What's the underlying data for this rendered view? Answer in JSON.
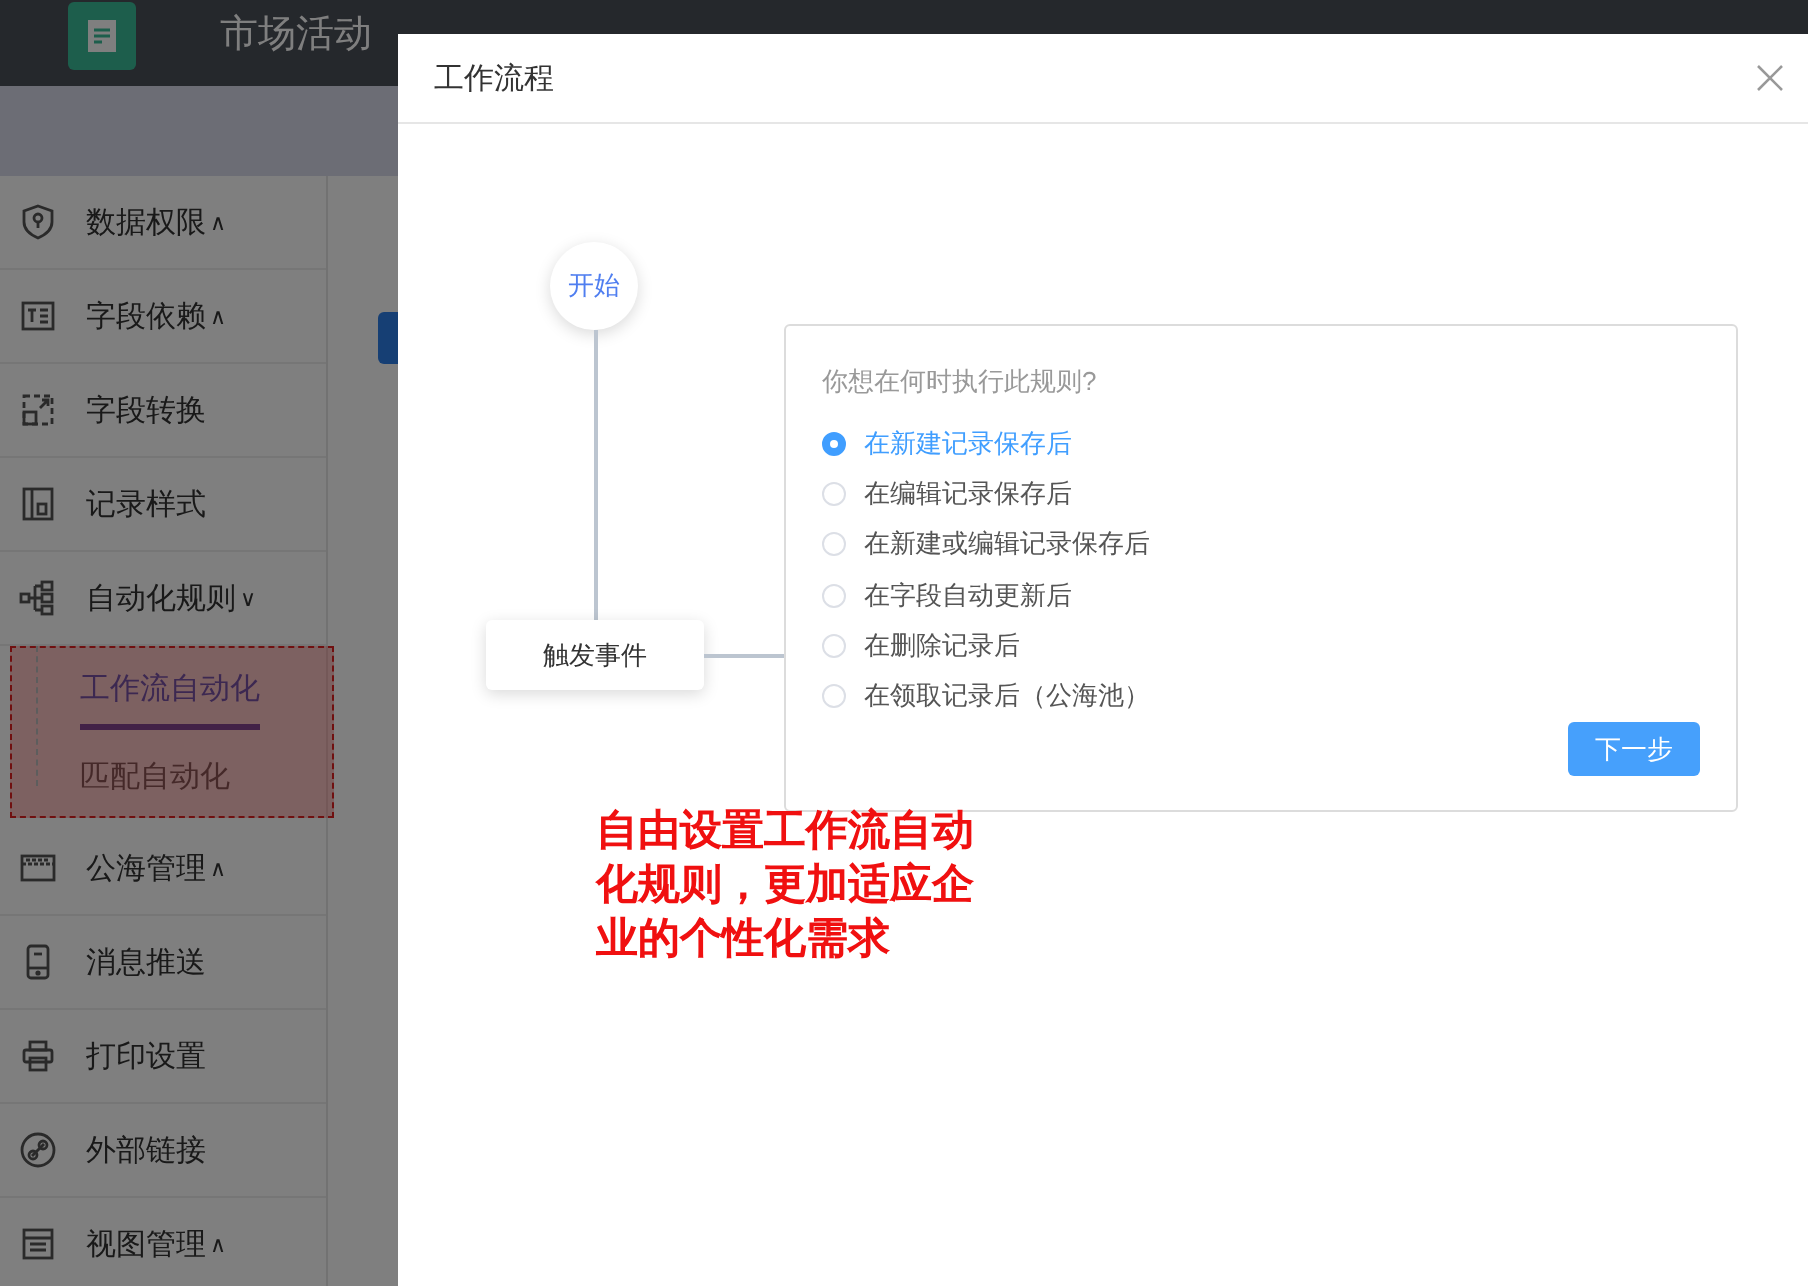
{
  "app": {
    "title": "市场活动"
  },
  "sidebar": {
    "items": [
      {
        "label": "数据权限",
        "caret": "∧"
      },
      {
        "label": "字段依赖",
        "caret": "∧"
      },
      {
        "label": "字段转换"
      },
      {
        "label": "记录样式"
      },
      {
        "label": "自动化规则",
        "caret": "∨",
        "children": [
          {
            "label": "工作流自动化",
            "selected": true
          },
          {
            "label": "匹配自动化",
            "selected": false
          }
        ]
      },
      {
        "label": "公海管理",
        "caret": "∧"
      },
      {
        "label": "消息推送"
      },
      {
        "label": "打印设置"
      },
      {
        "label": "外部链接"
      },
      {
        "label": "视图管理",
        "caret": "∧"
      }
    ]
  },
  "modal": {
    "title": "工作流程",
    "flow": {
      "start": "开始",
      "trigger": "触发事件"
    },
    "question": "你想在何时执行此规则?",
    "options": [
      {
        "label": "在新建记录保存后",
        "selected": true
      },
      {
        "label": "在编辑记录保存后",
        "selected": false
      },
      {
        "label": "在新建或编辑记录保存后",
        "selected": false
      },
      {
        "label": "在字段自动更新后",
        "selected": false
      },
      {
        "label": "在删除记录后",
        "selected": false
      },
      {
        "label": "在领取记录后（公海池）",
        "selected": false
      }
    ],
    "next_button": "下一步"
  },
  "annotation": {
    "text": "自由设置工作流自动化规则，更加适应企业的个性化需求"
  }
}
